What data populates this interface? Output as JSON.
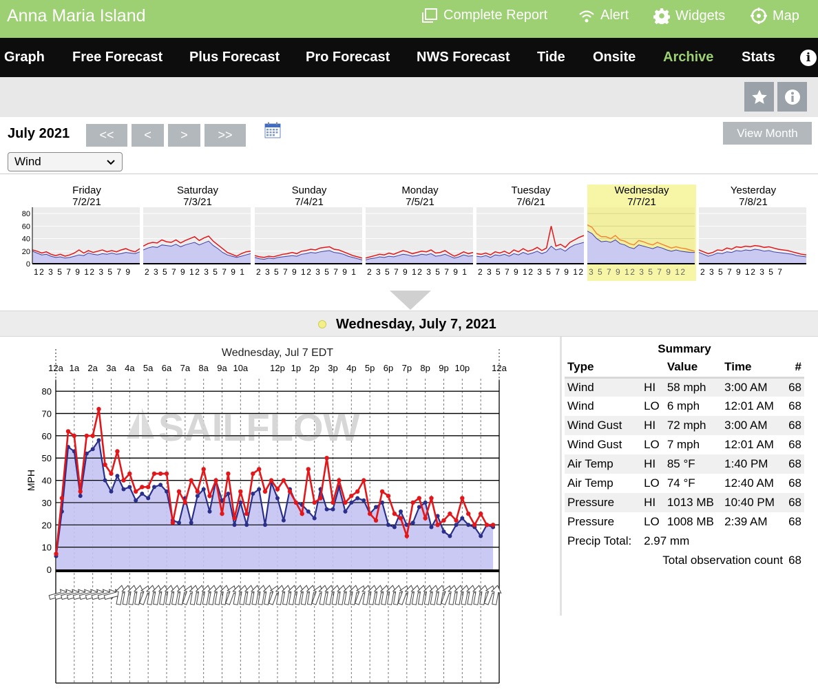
{
  "header": {
    "spot_name": "Anna Maria Island",
    "links": [
      {
        "label": "Complete Report",
        "icon": "report-icon"
      },
      {
        "label": "Alert",
        "icon": "wifi-alert-icon"
      },
      {
        "label": "Widgets",
        "icon": "gear-icon"
      },
      {
        "label": "Map",
        "icon": "map-pin-icon"
      }
    ]
  },
  "nav": {
    "items": [
      "Graph",
      "Free Forecast",
      "Plus Forecast",
      "Pro Forecast",
      "NWS Forecast",
      "Tide",
      "Onsite",
      "Archive",
      "Stats"
    ],
    "active": "Archive",
    "info_glyph": "i"
  },
  "archive": {
    "month_title": "July 2021",
    "pager": [
      "<<",
      "<",
      ">",
      ">>"
    ],
    "view_month_label": "View Month",
    "metric_select": "Wind"
  },
  "days": [
    {
      "name": "Friday",
      "date": "7/2/21",
      "ticks": "12 3 5 7 9 12 3 5 7 9",
      "wind": [
        20,
        17,
        14,
        15,
        12,
        10,
        11,
        9,
        10,
        12,
        14,
        13,
        17,
        15,
        14,
        16,
        15,
        17,
        15,
        16,
        18,
        17,
        16,
        19
      ],
      "gust": [
        22,
        20,
        17,
        19,
        15,
        13,
        15,
        12,
        14,
        17,
        22,
        17,
        21,
        18,
        20,
        22,
        19,
        21,
        19,
        22,
        24,
        21,
        19,
        24
      ]
    },
    {
      "name": "Saturday",
      "date": "7/3/21",
      "ticks": "2 3 5 7 9 12 3 5 7 9 1",
      "wind": [
        22,
        25,
        27,
        26,
        30,
        29,
        28,
        31,
        27,
        30,
        32,
        34,
        30,
        33,
        36,
        29,
        24,
        18,
        14,
        12,
        10,
        12,
        14,
        16
      ],
      "gust": [
        28,
        32,
        34,
        33,
        38,
        35,
        34,
        38,
        33,
        37,
        40,
        43,
        37,
        41,
        44,
        36,
        30,
        24,
        18,
        15,
        12,
        16,
        19,
        20
      ]
    },
    {
      "name": "Sunday",
      "date": "7/4/21",
      "ticks": "2 3 5 7 9 12 3 5 7 9 1",
      "wind": [
        10,
        8,
        7,
        9,
        8,
        10,
        11,
        12,
        13,
        12,
        15,
        16,
        18,
        17,
        19,
        20,
        21,
        18,
        17,
        15,
        12,
        10,
        8,
        6
      ],
      "gust": [
        13,
        11,
        10,
        12,
        11,
        13,
        15,
        16,
        18,
        16,
        20,
        21,
        23,
        22,
        25,
        26,
        27,
        23,
        22,
        19,
        16,
        13,
        11,
        9
      ]
    },
    {
      "name": "Monday",
      "date": "7/5/21",
      "ticks": "2 3 5 7 9 12 3 5 7 9 1",
      "wind": [
        6,
        8,
        9,
        11,
        10,
        12,
        11,
        13,
        15,
        14,
        12,
        13,
        15,
        14,
        16,
        12,
        13,
        15,
        12,
        9,
        11,
        14,
        12,
        13
      ],
      "gust": [
        9,
        11,
        13,
        15,
        14,
        17,
        15,
        18,
        21,
        19,
        16,
        18,
        20,
        19,
        22,
        17,
        18,
        21,
        16,
        12,
        15,
        19,
        16,
        18
      ]
    },
    {
      "name": "Tuesday",
      "date": "7/6/21",
      "ticks": "2 3 5 7 9 12 3 5 7 9 12",
      "wind": [
        12,
        11,
        13,
        10,
        14,
        13,
        15,
        12,
        16,
        14,
        18,
        15,
        17,
        20,
        16,
        19,
        28,
        22,
        24,
        20,
        26,
        30,
        32,
        34
      ],
      "gust": [
        16,
        15,
        17,
        14,
        19,
        17,
        20,
        16,
        22,
        19,
        24,
        20,
        22,
        26,
        21,
        25,
        60,
        28,
        31,
        26,
        34,
        38,
        42,
        45
      ]
    },
    {
      "name": "Wednesday",
      "date": "7/7/21",
      "ticks": "3 5 7 9 12 3 5 7 9 12",
      "wind": [
        52,
        48,
        40,
        35,
        36,
        34,
        38,
        32,
        30,
        26,
        24,
        30,
        28,
        26,
        24,
        27,
        25,
        22,
        20,
        22,
        20,
        19,
        18,
        18
      ],
      "gust": [
        62,
        58,
        48,
        43,
        43,
        40,
        45,
        38,
        36,
        32,
        30,
        37,
        35,
        32,
        30,
        34,
        31,
        28,
        25,
        27,
        25,
        24,
        22,
        20
      ]
    },
    {
      "name": "Yesterday",
      "date": "7/8/21",
      "ticks": "2 3 5 7 9 12 3 5 7",
      "wind": [
        18,
        15,
        12,
        14,
        17,
        16,
        19,
        18,
        21,
        20,
        22,
        21,
        23,
        22,
        20,
        21,
        19,
        18,
        17,
        16,
        15,
        13,
        12,
        11
      ],
      "gust": [
        22,
        19,
        16,
        18,
        22,
        21,
        25,
        23,
        27,
        26,
        28,
        27,
        29,
        28,
        26,
        27,
        25,
        23,
        22,
        21,
        19,
        17,
        15,
        14
      ]
    }
  ],
  "selected_day_index": 5,
  "day_header": {
    "title": "Wednesday, July 7, 2021"
  },
  "chart_data": {
    "type": "line",
    "title": "Wednesday, Jul 7 EDT",
    "ylabel": "MPH",
    "ylim": [
      0,
      80
    ],
    "yticks": [
      0,
      10,
      20,
      30,
      40,
      50,
      60,
      70,
      80
    ],
    "xticks": [
      "12a",
      "1a",
      "2a",
      "3a",
      "4a",
      "5a",
      "6a",
      "7a",
      "8a",
      "9a",
      "10a",
      "12p",
      "1p",
      "2p",
      "3p",
      "4p",
      "5p",
      "6p",
      "7p",
      "8p",
      "9p",
      "10p",
      "12a"
    ],
    "xtick_hours": [
      0,
      1,
      2,
      3,
      4,
      5,
      6,
      7,
      8,
      9,
      10,
      12,
      13,
      14,
      15,
      16,
      17,
      18,
      19,
      20,
      21,
      22,
      24
    ],
    "watermark": "SAILFLOW",
    "x_hours": [
      0.02,
      0.33,
      0.67,
      1.0,
      1.33,
      1.67,
      2.0,
      2.33,
      2.67,
      3.0,
      3.33,
      3.67,
      4.0,
      4.33,
      4.67,
      5.0,
      5.33,
      5.67,
      6.0,
      6.33,
      6.67,
      7.0,
      7.33,
      7.67,
      8.0,
      8.33,
      8.67,
      9.0,
      9.33,
      9.67,
      10.0,
      10.33,
      10.67,
      11.0,
      11.33,
      11.67,
      12.0,
      12.33,
      12.67,
      13.0,
      13.33,
      13.67,
      14.0,
      14.33,
      14.67,
      15.0,
      15.33,
      15.67,
      16.0,
      16.33,
      16.67,
      17.0,
      17.33,
      17.67,
      18.0,
      18.33,
      18.67,
      19.0,
      19.33,
      19.67,
      20.0,
      20.33,
      20.67,
      21.0,
      21.33,
      21.67,
      22.0,
      22.33,
      22.67,
      23.0,
      23.33,
      23.67
    ],
    "series": [
      {
        "name": "Wind",
        "color": "#2a2f8a",
        "values": [
          6,
          26,
          55,
          53,
          33,
          52,
          54,
          58,
          40,
          35,
          42,
          36,
          37,
          31,
          34,
          32,
          37,
          38,
          35,
          22,
          21,
          32,
          21,
          33,
          36,
          26,
          40,
          31,
          34,
          20,
          30,
          20,
          34,
          36,
          20,
          39,
          32,
          22,
          36,
          30,
          29,
          26,
          23,
          36,
          27,
          27,
          37,
          26,
          30,
          32,
          31,
          25,
          28,
          30,
          20,
          19,
          26,
          20,
          21,
          28,
          30,
          19,
          24,
          17,
          15,
          20,
          23,
          20,
          19,
          15,
          20,
          19
        ]
      },
      {
        "name": "Wind Gust",
        "color": "#e3161a",
        "values": [
          7,
          32,
          62,
          60,
          35,
          60,
          60,
          72,
          47,
          43,
          53,
          40,
          43,
          35,
          37,
          37,
          43,
          43,
          43,
          21,
          35,
          30,
          40,
          35,
          45,
          33,
          40,
          25,
          43,
          23,
          35,
          25,
          43,
          45,
          35,
          40,
          36,
          40,
          35,
          30,
          25,
          45,
          30,
          32,
          50,
          30,
          40,
          30,
          33,
          35,
          40,
          25,
          22,
          35,
          33,
          25,
          23,
          15,
          30,
          32,
          23,
          32,
          20,
          22,
          25,
          22,
          32,
          25,
          20,
          25,
          20,
          20
        ]
      }
    ]
  },
  "summary": {
    "title": "Summary",
    "columns": [
      "Type",
      "",
      "Value",
      "Time",
      "#"
    ],
    "rows": [
      {
        "type": "Wind",
        "hilo": "HI",
        "value": "58 mph",
        "time": "3:00 AM",
        "count": "68"
      },
      {
        "type": "Wind",
        "hilo": "LO",
        "value": "6 mph",
        "time": "12:01 AM",
        "count": "68"
      },
      {
        "type": "Wind Gust",
        "hilo": "HI",
        "value": "72 mph",
        "time": "3:00 AM",
        "count": "68"
      },
      {
        "type": "Wind Gust",
        "hilo": "LO",
        "value": "7 mph",
        "time": "12:01 AM",
        "count": "68"
      },
      {
        "type": "Air Temp",
        "hilo": "HI",
        "value": "85 °F",
        "time": "1:40 PM",
        "count": "68"
      },
      {
        "type": "Air Temp",
        "hilo": "LO",
        "value": "74 °F",
        "time": "12:40 AM",
        "count": "68"
      },
      {
        "type": "Pressure",
        "hilo": "HI",
        "value": "1013 MB",
        "time": "10:40 PM",
        "count": "68"
      },
      {
        "type": "Pressure",
        "hilo": "LO",
        "value": "1008 MB",
        "time": "2:39 AM",
        "count": "68"
      }
    ],
    "precip_label": "Precip Total:",
    "precip_value": "2.97 mm",
    "total_label": "Total observation count",
    "total_value": "68"
  }
}
